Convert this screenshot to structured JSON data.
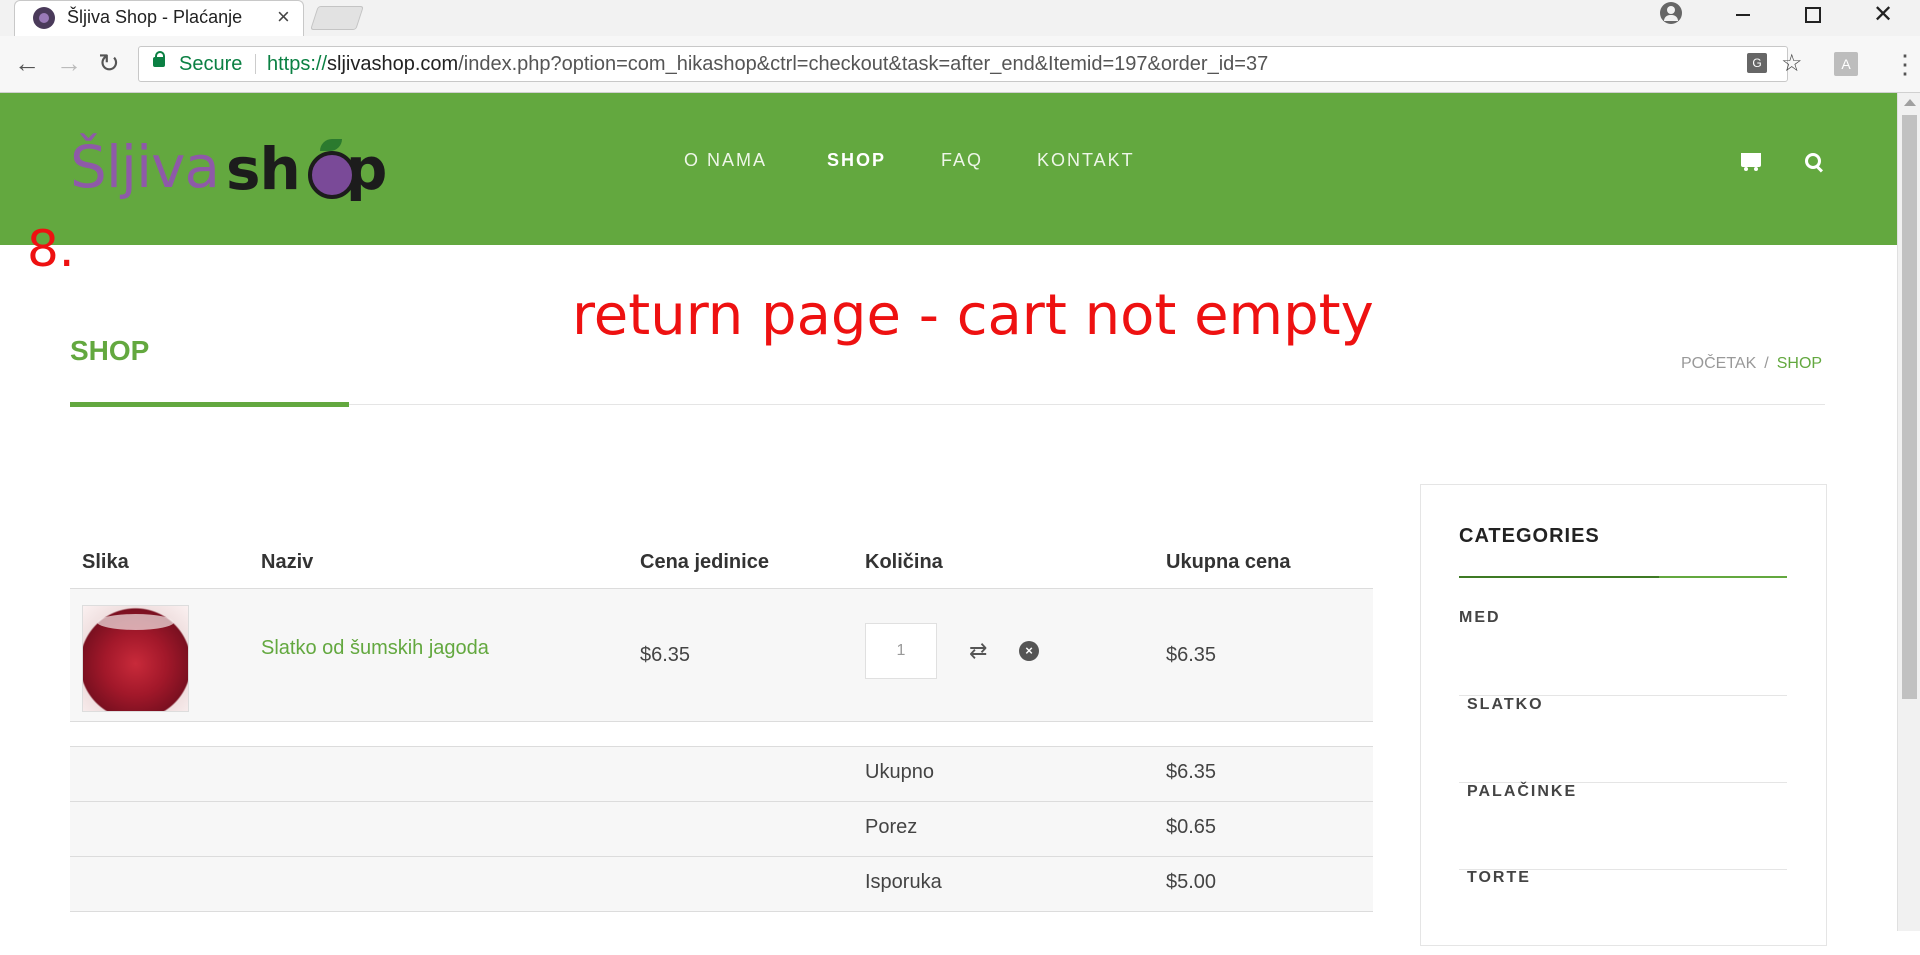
{
  "browser": {
    "tab_title": "Šljiva Shop - Plaćanje",
    "secure_label": "Secure",
    "url_protocol": "https://",
    "url_host": "sljivashop.com",
    "url_path": "/index.php?option=com_hikashop&ctrl=checkout&task=after_end&Itemid=197&order_id=37"
  },
  "site": {
    "logo_left": "Šljiva",
    "logo_right": "sh",
    "logo_right_tail": "p",
    "nav": [
      "O NAMA",
      "SHOP",
      "FAQ",
      "KONTAKT"
    ],
    "active_nav": "SHOP",
    "brand_color": "#63a83f",
    "logo_plum_color": "#8e5aa8"
  },
  "annotations": {
    "step": "8.",
    "note": "return page - cart not empty",
    "color": "#ee1111"
  },
  "page": {
    "title": "SHOP",
    "breadcrumb": [
      "POČETAK",
      "SHOP"
    ]
  },
  "cart": {
    "headers": [
      "Slika",
      "Naziv",
      "Cena jedinice",
      "Količina",
      "Ukupna cena"
    ],
    "items": [
      {
        "name": "Slatko od šumskih jagoda",
        "unit_price": "$6.35",
        "quantity": "1",
        "total": "$6.35"
      }
    ],
    "summary": [
      {
        "label": "Ukupno",
        "value": "$6.35"
      },
      {
        "label": "Porez",
        "value": "$0.65"
      },
      {
        "label": "Isporuka",
        "value": "$5.00"
      }
    ]
  },
  "sidebar": {
    "title": "CATEGORIES",
    "categories": [
      "MED",
      "SLATKO",
      "PALAČINKE",
      "TORTE"
    ]
  }
}
